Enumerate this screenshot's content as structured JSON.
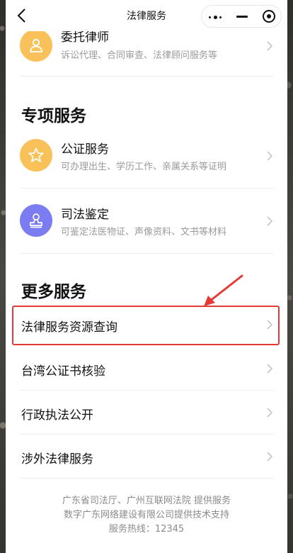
{
  "navbar": {
    "title": "法律服务",
    "back_icon": "chevron-left-icon",
    "capsule_icons": [
      "more-dots-icon",
      "minimize-icon",
      "close-target-icon"
    ]
  },
  "top_item": {
    "title": "委托律师",
    "desc": "诉讼代理、合同审查、法律顾问服务等",
    "icon": "person-icon",
    "icon_color": "#F9C15A"
  },
  "special_section": {
    "title": "专项服务",
    "items": [
      {
        "title": "公证服务",
        "desc": "可办理出生、学历工作、亲属关系等证明",
        "icon": "star-icon",
        "icon_color": "#F9C15A"
      },
      {
        "title": "司法鉴定",
        "desc": "可鉴定法医物证、声像资料、文书等材料",
        "icon": "stamp-icon",
        "icon_color": "#7C7CF2"
      }
    ]
  },
  "more_section": {
    "title": "更多服务",
    "items": [
      {
        "label": "法律服务资源查询"
      },
      {
        "label": "台湾公证书核验"
      },
      {
        "label": "行政执法公开"
      },
      {
        "label": "涉外法律服务"
      }
    ]
  },
  "footer": {
    "line1": "广东省司法厅、广州互联网法院 提供服务",
    "line2": "数字广东网络建设有限公司提供技术支持",
    "line3": "服务热线：12345"
  },
  "annotation": {
    "highlight_color": "#E53935"
  }
}
